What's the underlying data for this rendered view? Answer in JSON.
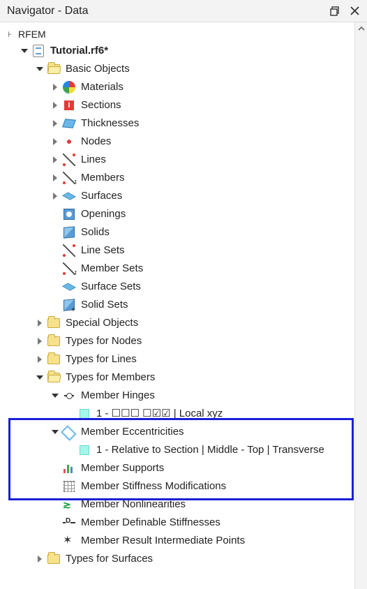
{
  "titlebar": {
    "title": "Navigator - Data"
  },
  "root": {
    "app_label": "RFEM"
  },
  "tree": {
    "file": "Tutorial.rf6*",
    "basic_objects": {
      "label": "Basic Objects",
      "materials": "Materials",
      "sections": "Sections",
      "thicknesses": "Thicknesses",
      "nodes": "Nodes",
      "lines": "Lines",
      "members": "Members",
      "surfaces": "Surfaces",
      "openings": "Openings",
      "solids": "Solids",
      "line_sets": "Line Sets",
      "member_sets": "Member Sets",
      "surface_sets": "Surface Sets",
      "solid_sets": "Solid Sets"
    },
    "special_objects": "Special Objects",
    "types_for_nodes": "Types for Nodes",
    "types_for_lines": "Types for Lines",
    "types_for_members": {
      "label": "Types for Members",
      "hinges": {
        "label": "Member Hinges",
        "item1": "1 - ☐☐☐ ☐☑☑ | Local xyz"
      },
      "eccentricities": {
        "label": "Member Eccentricities",
        "item1": "1 - Relative to Section | Middle - Top | Transverse"
      },
      "supports": "Member Supports",
      "stiff_mod": "Member Stiffness Modifications",
      "nonlin": "Member Nonlinearities",
      "def_stiff": "Member Definable Stiffnesses",
      "result_pts": "Member Result Intermediate Points"
    },
    "types_for_surfaces": "Types for Surfaces"
  }
}
